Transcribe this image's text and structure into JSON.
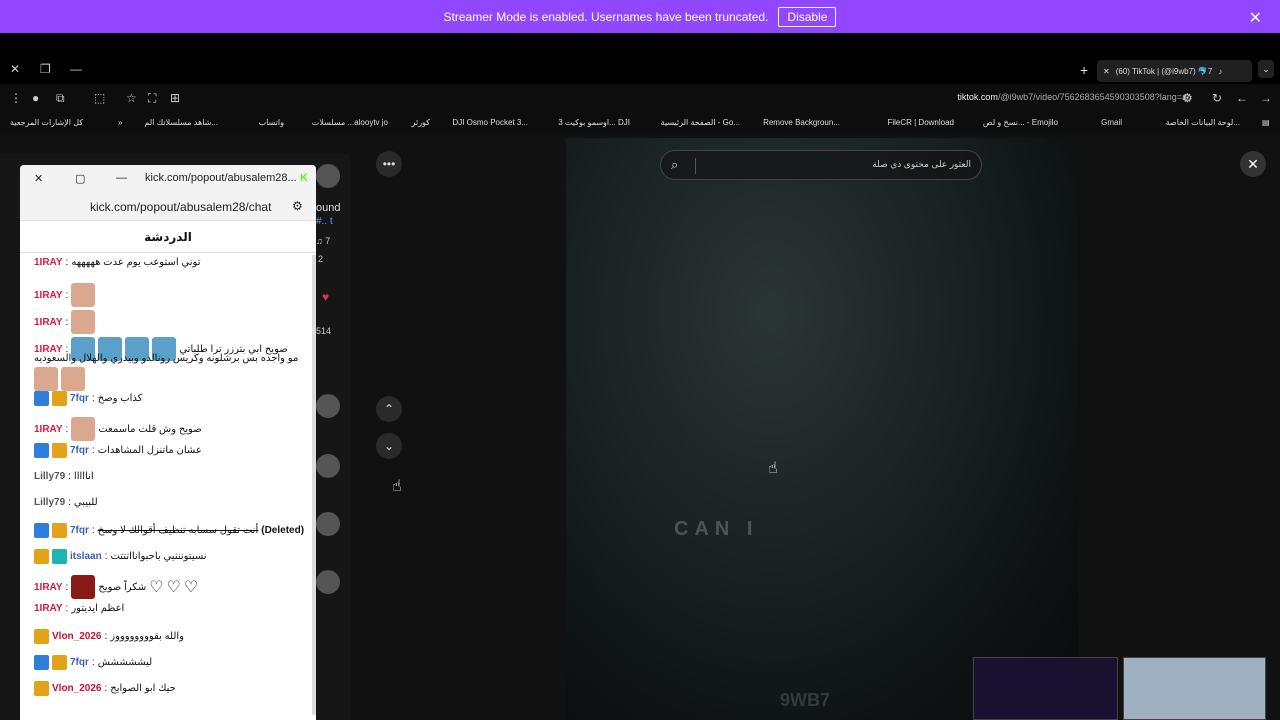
{
  "banner": {
    "text": "Streamer Mode is enabled. Usernames have been truncated.",
    "disable_label": "Disable",
    "close_glyph": "✕"
  },
  "browser": {
    "tab_title": "(60) TikTok | (@i9wb7) 🐬7",
    "url_host": "tiktok.com",
    "url_path": "/@i9wb7/video/7562683654590303508?lang=ar",
    "bookmarks": [
      "لوحة البيانات الخاصة...",
      "Gmail",
      "نسخ و لص... - Emojilo",
      "FileCR | Download",
      "Remove Backgroun...",
      "الصفحة الرئيسية - Go...",
      "اوسمو بوكيت 3... DJI",
      "DJI Osmo Pocket 3...",
      "كورئر",
      "مسلسلات ...alooytv jo",
      "واتساب",
      "شاهد مسلسلاتك الم...",
      "كل الإشارات المرجعية"
    ]
  },
  "tiktok": {
    "search_placeholder": "العثور على محتوى ذي صلة",
    "watermark_1": "CAN I",
    "watermark_2": "9WB7",
    "side_texts": [
      "ound",
      "#.. t",
      "♫ 7",
      "2",
      "514"
    ]
  },
  "popup": {
    "window_title": "kick.com/popout/abusalem28...",
    "url": "kick.com/popout/abusalem28/chat",
    "chat_header": "الدردشة"
  },
  "chat": [
    {
      "user": "1IRAY",
      "color": "red",
      "badges": [],
      "text": "توني استوعب يوم عدت هههههه",
      "emotes": 0
    },
    {
      "user": "1IRAY",
      "color": "red",
      "badges": [],
      "text": "",
      "emotes": 1
    },
    {
      "user": "1IRAY",
      "color": "red",
      "badges": [],
      "text": "",
      "emotes": 1
    },
    {
      "user": "1IRAY",
      "color": "red",
      "badges": [],
      "text": "صويح ابي بترزر ترا طلباتي",
      "emotes": 4,
      "line2": "مو واجده بس برشلونه وكريس رونالدو وبيدري والهلال والسعوديه"
    },
    {
      "user": "7fqr",
      "color": "blue",
      "badges": [
        "blue",
        "gold"
      ],
      "text": "كذاب وصخ",
      "emotes": 0
    },
    {
      "user": "1IRAY",
      "color": "red",
      "badges": [],
      "text": "صويح وش قلت ماسمعت",
      "emotes": 1
    },
    {
      "user": "7fqr",
      "color": "blue",
      "badges": [
        "blue",
        "gold"
      ],
      "text": "عشان ماتنزل المشاهدات",
      "emotes": 0
    },
    {
      "user": "Lilly79",
      "color": "grey",
      "badges": [],
      "text": "انااااا",
      "emotes": 0
    },
    {
      "user": "Lilly79",
      "color": "grey",
      "badges": [],
      "text": "للبيبي",
      "emotes": 0
    },
    {
      "user": "7fqr",
      "color": "blue",
      "badges": [
        "blue",
        "gold"
      ],
      "text": "أنت تقول سسابه تنظيف أقوالك لا وسخ",
      "deleted": "(Deleted)",
      "emotes": 0
    },
    {
      "user": "itslaan",
      "color": "blue",
      "badges": [
        "gold",
        "teal"
      ],
      "text": "نسيتونننيي باحبوانااتتتت",
      "emotes": 0
    },
    {
      "user": "1IRAY",
      "color": "red",
      "badges": [],
      "text": "شكراً صويح",
      "emotes": 1,
      "hearts": 3
    },
    {
      "user": "1IRAY",
      "color": "red",
      "badges": [],
      "text": "اعظم ايديتور",
      "emotes": 0
    },
    {
      "user": "Vlon_2026",
      "color": "crimson",
      "badges": [
        "gold"
      ],
      "text": "والله بقووووووووز",
      "emotes": 0
    },
    {
      "user": "7fqr",
      "color": "blue",
      "badges": [
        "blue",
        "gold"
      ],
      "text": "ليششششش",
      "emotes": 0
    },
    {
      "user": "Vlon_2026",
      "color": "crimson",
      "badges": [
        "gold"
      ],
      "text": "حيك ابو الصوايح",
      "emotes": 0
    }
  ]
}
